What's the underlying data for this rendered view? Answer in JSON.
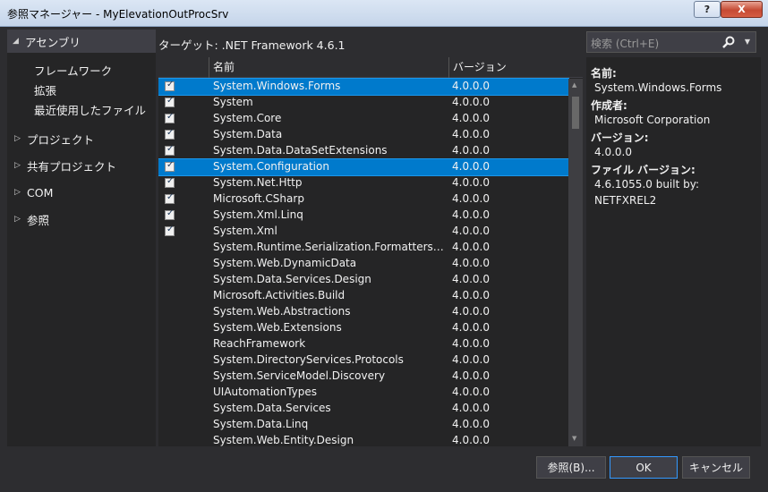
{
  "window": {
    "title": "参照マネージャー - MyElevationOutProcSrv",
    "help_label": "?",
    "close_label": "X"
  },
  "nav": {
    "assemblies": "アセンブリ",
    "assembly_items": [
      "フレームワーク",
      "拡張",
      "最近使用したファイル"
    ],
    "groups": [
      "プロジェクト",
      "共有プロジェクト",
      "COM",
      "参照"
    ]
  },
  "target": "ターゲット: .NET Framework 4.6.1",
  "search": {
    "placeholder": "検索 (Ctrl+E)"
  },
  "grid": {
    "columns": [
      "名前",
      "バージョン"
    ],
    "rows": [
      {
        "name": "System.Windows.Forms",
        "version": "4.0.0.0",
        "checked": true,
        "selected": true
      },
      {
        "name": "System",
        "version": "4.0.0.0",
        "checked": true,
        "selected": false
      },
      {
        "name": "System.Core",
        "version": "4.0.0.0",
        "checked": true,
        "selected": false
      },
      {
        "name": "System.Data",
        "version": "4.0.0.0",
        "checked": true,
        "selected": false
      },
      {
        "name": "System.Data.DataSetExtensions",
        "version": "4.0.0.0",
        "checked": true,
        "selected": false
      },
      {
        "name": "System.Configuration",
        "version": "4.0.0.0",
        "checked": true,
        "selected": true
      },
      {
        "name": "System.Net.Http",
        "version": "4.0.0.0",
        "checked": true,
        "selected": false
      },
      {
        "name": "Microsoft.CSharp",
        "version": "4.0.0.0",
        "checked": true,
        "selected": false
      },
      {
        "name": "System.Xml.Linq",
        "version": "4.0.0.0",
        "checked": true,
        "selected": false
      },
      {
        "name": "System.Xml",
        "version": "4.0.0.0",
        "checked": true,
        "selected": false
      },
      {
        "name": "System.Runtime.Serialization.Formatters…",
        "version": "4.0.0.0",
        "checked": false,
        "selected": false
      },
      {
        "name": "System.Web.DynamicData",
        "version": "4.0.0.0",
        "checked": false,
        "selected": false
      },
      {
        "name": "System.Data.Services.Design",
        "version": "4.0.0.0",
        "checked": false,
        "selected": false
      },
      {
        "name": "Microsoft.Activities.Build",
        "version": "4.0.0.0",
        "checked": false,
        "selected": false
      },
      {
        "name": "System.Web.Abstractions",
        "version": "4.0.0.0",
        "checked": false,
        "selected": false
      },
      {
        "name": "System.Web.Extensions",
        "version": "4.0.0.0",
        "checked": false,
        "selected": false
      },
      {
        "name": "ReachFramework",
        "version": "4.0.0.0",
        "checked": false,
        "selected": false
      },
      {
        "name": "System.DirectoryServices.Protocols",
        "version": "4.0.0.0",
        "checked": false,
        "selected": false
      },
      {
        "name": "System.ServiceModel.Discovery",
        "version": "4.0.0.0",
        "checked": false,
        "selected": false
      },
      {
        "name": "UIAutomationTypes",
        "version": "4.0.0.0",
        "checked": false,
        "selected": false
      },
      {
        "name": "System.Data.Services",
        "version": "4.0.0.0",
        "checked": false,
        "selected": false
      },
      {
        "name": "System.Data.Linq",
        "version": "4.0.0.0",
        "checked": false,
        "selected": false
      },
      {
        "name": "System.Web.Entity.Design",
        "version": "4.0.0.0",
        "checked": false,
        "selected": false
      }
    ]
  },
  "details": {
    "name_key": "名前:",
    "name_val": "System.Windows.Forms",
    "author_key": "作成者:",
    "author_val": "Microsoft Corporation",
    "version_key": "バージョン:",
    "version_val": "4.0.0.0",
    "file_version_key": "ファイル バージョン:",
    "file_version_val1": "4.6.1055.0 built by:",
    "file_version_val2": "NETFXREL2"
  },
  "buttons": {
    "browse": "参照(B)...",
    "ok": "OK",
    "cancel": "キャンセル"
  },
  "colors": {
    "selection": "#007acc",
    "panel": "#252526",
    "background": "#2d2d30",
    "ok_border": "#3399ff"
  },
  "icons": {
    "search": "magnifier-icon",
    "checkbox": "check-icon"
  }
}
